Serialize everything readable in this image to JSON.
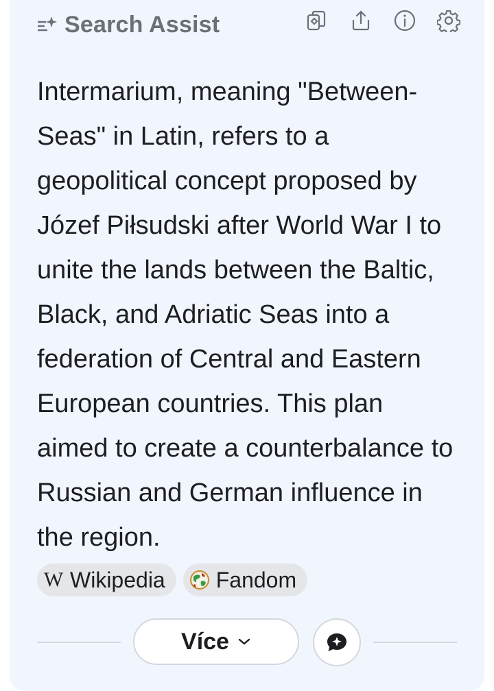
{
  "header": {
    "title": "Search Assist",
    "icons": [
      "copy-icon",
      "share-icon",
      "info-icon",
      "settings-icon"
    ]
  },
  "answer": {
    "text": "Intermarium, meaning \"Between-Seas\" in Latin, refers to a geopolitical concept proposed by Józef Piłsudski after World War I to unite the lands between the Baltic, Black, and Adriatic Seas into a federation of Central and Eastern European countries. This plan aimed to create a counterbalance to Russian and German influence in the region."
  },
  "sources": [
    {
      "label": "Wikipedia",
      "icon": "wikipedia-icon"
    },
    {
      "label": "Fandom",
      "icon": "fandom-icon"
    }
  ],
  "footer": {
    "more_label": "Více",
    "chat_icon": "chat-icon"
  },
  "colors": {
    "card_bg": "#f1f5fd",
    "title": "#6c6f76",
    "text": "#1d1e21",
    "chip_bg": "#e4e6ea"
  }
}
